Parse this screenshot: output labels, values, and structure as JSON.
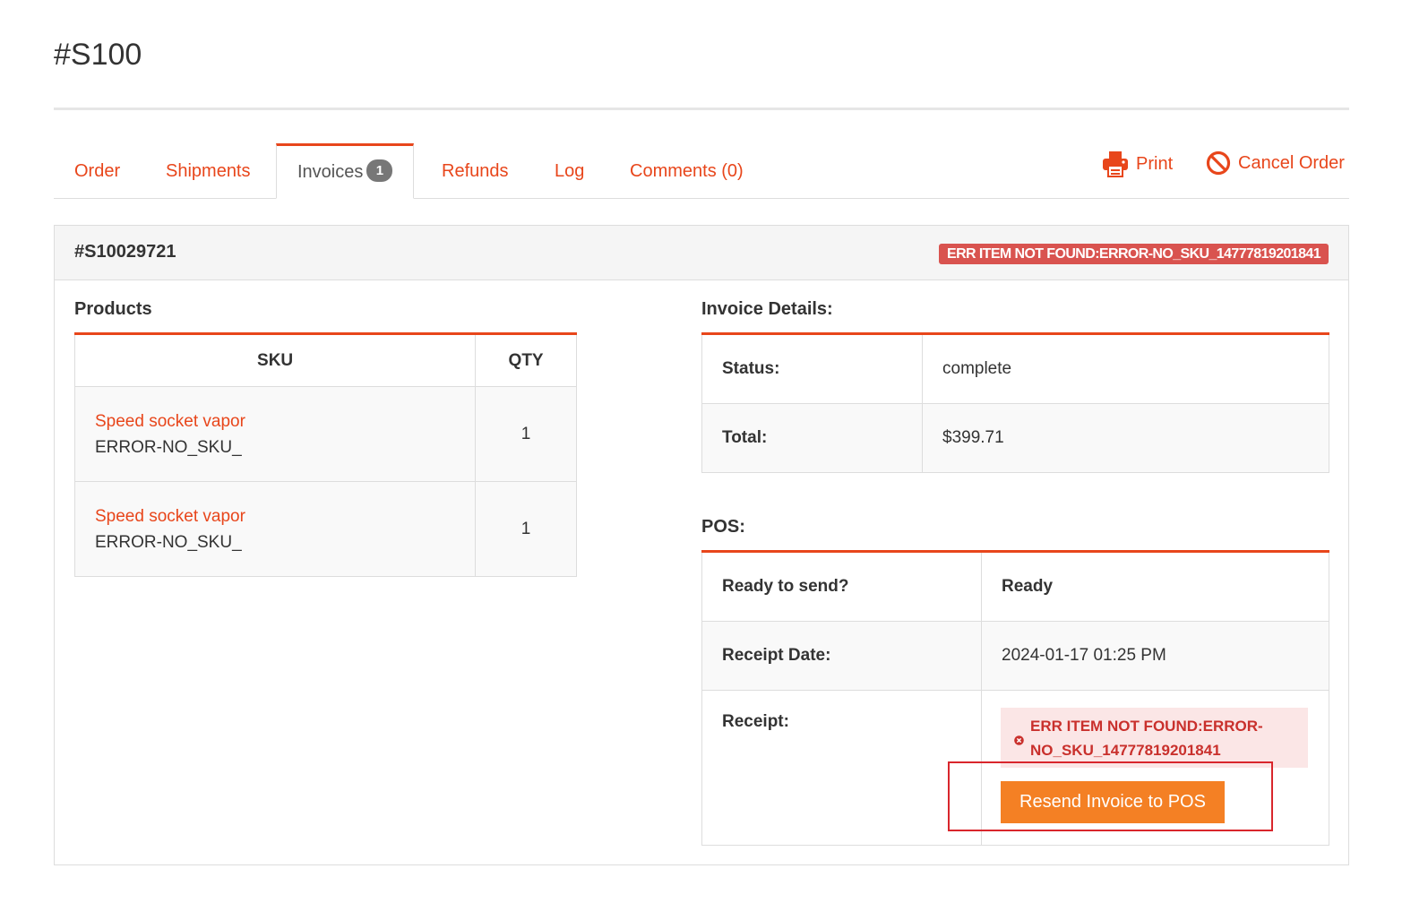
{
  "page_title": "#S100",
  "tabs": [
    {
      "label": "Order"
    },
    {
      "label": "Shipments"
    },
    {
      "label": "Invoices",
      "badge": "1"
    },
    {
      "label": "Refunds"
    },
    {
      "label": "Log"
    },
    {
      "label": "Comments (0)"
    }
  ],
  "actions": {
    "print_label": "Print",
    "cancel_label": "Cancel Order"
  },
  "invoice": {
    "id": "#S10029721",
    "error_label": "ERR ITEM NOT FOUND:ERROR-NO_SKU_14777819201841"
  },
  "products": {
    "title": "Products",
    "headers": {
      "sku": "SKU",
      "qty": "QTY"
    },
    "rows": [
      {
        "name": "Speed socket vapor",
        "sku": "ERROR-NO_SKU_",
        "qty": "1"
      },
      {
        "name": "Speed socket vapor",
        "sku": "ERROR-NO_SKU_",
        "qty": "1"
      }
    ]
  },
  "invoice_details": {
    "title": "Invoice Details:",
    "status_label": "Status:",
    "status_value": "complete",
    "total_label": "Total:",
    "total_value": "$399.71"
  },
  "pos": {
    "title": "POS:",
    "ready_label": "Ready to send?",
    "ready_value": "Ready",
    "receipt_date_label": "Receipt Date:",
    "receipt_date_value": "2024-01-17 01:25 PM",
    "receipt_label": "Receipt:",
    "receipt_error": "ERR ITEM NOT FOUND:ERROR-NO_SKU_14777819201841",
    "resend_button": "Resend Invoice to POS"
  },
  "colors": {
    "accent": "#e8461b",
    "danger": "#d9534f",
    "button": "#f48024",
    "highlight": "#d9262c"
  }
}
